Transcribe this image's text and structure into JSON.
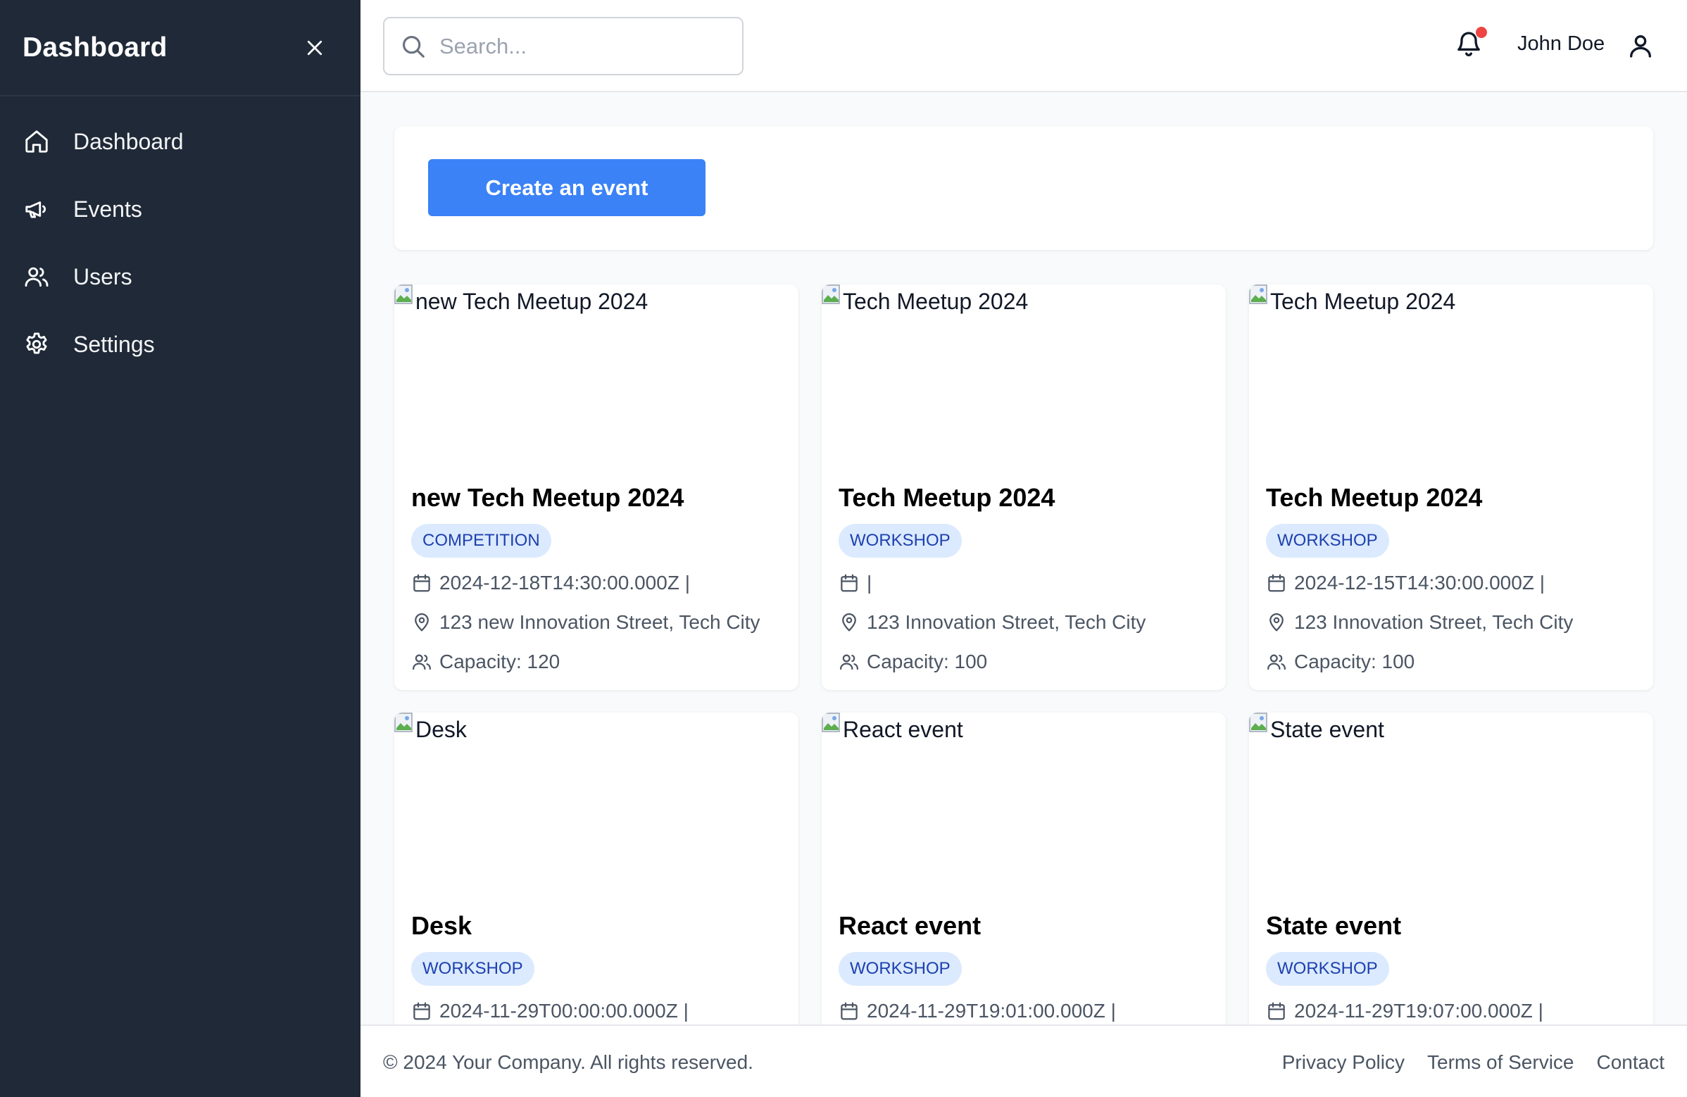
{
  "sidebar": {
    "title": "Dashboard",
    "items": [
      {
        "label": "Dashboard",
        "icon": "home-icon"
      },
      {
        "label": "Events",
        "icon": "megaphone-icon"
      },
      {
        "label": "Users",
        "icon": "users-icon"
      },
      {
        "label": "Settings",
        "icon": "gear-icon"
      }
    ]
  },
  "header": {
    "search_placeholder": "Search...",
    "user_name": "John Doe",
    "notification_dot_color": "#ef4444"
  },
  "main": {
    "create_button_label": "Create an event",
    "events": [
      {
        "image_alt": "new Tech Meetup 2024",
        "title": "new Tech Meetup 2024",
        "category": "COMPETITION",
        "date": "2024-12-18T14:30:00.000Z |",
        "location": "123 new Innovation Street, Tech City",
        "capacity": "Capacity: 120"
      },
      {
        "image_alt": "Tech Meetup 2024",
        "title": "Tech Meetup 2024",
        "category": "WORKSHOP",
        "date": "|",
        "location": "123 Innovation Street, Tech City",
        "capacity": "Capacity: 100"
      },
      {
        "image_alt": "Tech Meetup 2024",
        "title": "Tech Meetup 2024",
        "category": "WORKSHOP",
        "date": "2024-12-15T14:30:00.000Z |",
        "location": "123 Innovation Street, Tech City",
        "capacity": "Capacity: 100"
      },
      {
        "image_alt": "Desk",
        "title": "Desk",
        "category": "WORKSHOP",
        "date": "2024-11-29T00:00:00.000Z |"
      },
      {
        "image_alt": "React event",
        "title": "React event",
        "category": "WORKSHOP",
        "date": "2024-11-29T19:01:00.000Z |"
      },
      {
        "image_alt": "State event",
        "title": "State event",
        "category": "WORKSHOP",
        "date": "2024-11-29T19:07:00.000Z |"
      }
    ]
  },
  "footer": {
    "copyright": "© 2024 Your Company. All rights reserved.",
    "links": [
      "Privacy Policy",
      "Terms of Service",
      "Contact"
    ]
  },
  "colors": {
    "sidebar_bg": "#1f2937",
    "accent": "#3b82f6",
    "badge_bg": "#dbeafe",
    "badge_text": "#1e40af"
  }
}
